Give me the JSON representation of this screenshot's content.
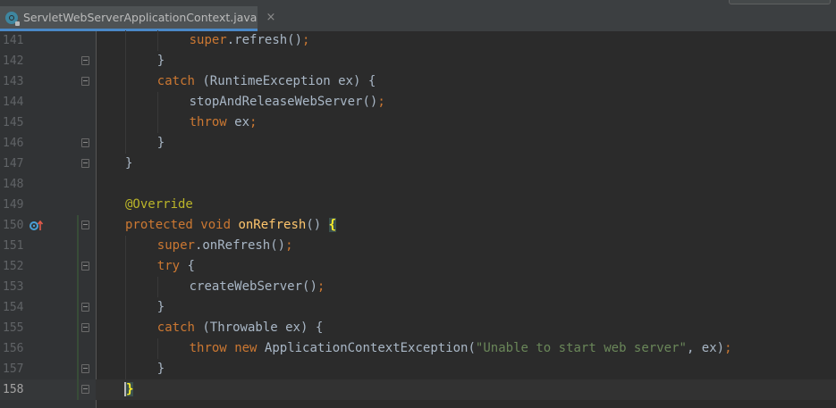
{
  "tab": {
    "filename": "ServletWebServerApplicationContext.java",
    "close_glyph": "×",
    "file_icon": "class-icon"
  },
  "colors": {
    "keyword": "#cc7832",
    "annotation": "#bbb529",
    "method_declaration": "#ffc66d",
    "string": "#6a8759",
    "text": "#a9b7c6",
    "line_number": "#606366",
    "background": "#2b2b2b"
  },
  "editor": {
    "current_line": "158",
    "lines": [
      {
        "num": "141",
        "parts": [
          {
            "t": "super",
            "c": "kw"
          },
          {
            "t": ".refresh()"
          },
          {
            "t": ";",
            "c": "semi"
          }
        ]
      },
      {
        "num": "142",
        "parts": [
          {
            "t": "}"
          }
        ]
      },
      {
        "num": "143",
        "parts": [
          {
            "t": "catch",
            "c": "kw"
          },
          {
            "t": " (RuntimeException ex) {"
          }
        ]
      },
      {
        "num": "144",
        "parts": [
          {
            "t": "stopAndReleaseWebServer()"
          },
          {
            "t": ";",
            "c": "semi"
          }
        ]
      },
      {
        "num": "145",
        "parts": [
          {
            "t": "throw",
            "c": "kw"
          },
          {
            "t": " ex"
          },
          {
            "t": ";",
            "c": "semi"
          }
        ]
      },
      {
        "num": "146",
        "parts": [
          {
            "t": "}"
          }
        ]
      },
      {
        "num": "147",
        "parts": [
          {
            "t": "}"
          }
        ]
      },
      {
        "num": "148",
        "parts": []
      },
      {
        "num": "149",
        "parts": [
          {
            "t": "@Override",
            "c": "ann"
          }
        ]
      },
      {
        "num": "150",
        "parts": [
          {
            "t": "protected",
            "c": "kw"
          },
          {
            "t": " "
          },
          {
            "t": "void",
            "c": "kw"
          },
          {
            "t": " "
          },
          {
            "t": "onRefresh",
            "c": "fn"
          },
          {
            "t": "() "
          },
          {
            "t": "{",
            "c": "brace-hl"
          }
        ]
      },
      {
        "num": "151",
        "parts": [
          {
            "t": "super",
            "c": "kw"
          },
          {
            "t": ".onRefresh()"
          },
          {
            "t": ";",
            "c": "semi"
          }
        ]
      },
      {
        "num": "152",
        "parts": [
          {
            "t": "try",
            "c": "kw"
          },
          {
            "t": " {"
          }
        ]
      },
      {
        "num": "153",
        "parts": [
          {
            "t": "createWebServer()"
          },
          {
            "t": ";",
            "c": "semi"
          }
        ]
      },
      {
        "num": "154",
        "parts": [
          {
            "t": "}"
          }
        ]
      },
      {
        "num": "155",
        "parts": [
          {
            "t": "catch",
            "c": "kw"
          },
          {
            "t": " (Throwable ex) {"
          }
        ]
      },
      {
        "num": "156",
        "parts": [
          {
            "t": "throw",
            "c": "kw"
          },
          {
            "t": " "
          },
          {
            "t": "new",
            "c": "kw"
          },
          {
            "t": " ApplicationContextException("
          },
          {
            "t": "\"Unable to start web server\"",
            "c": "str"
          },
          {
            "t": ", ex)"
          },
          {
            "t": ";",
            "c": "semi"
          }
        ]
      },
      {
        "num": "157",
        "parts": [
          {
            "t": "}"
          }
        ]
      },
      {
        "num": "158",
        "parts": [
          {
            "t": "}",
            "c": "brace-hl caret"
          }
        ]
      }
    ],
    "gutter_markers": {
      "150": "override-method-icon"
    }
  }
}
